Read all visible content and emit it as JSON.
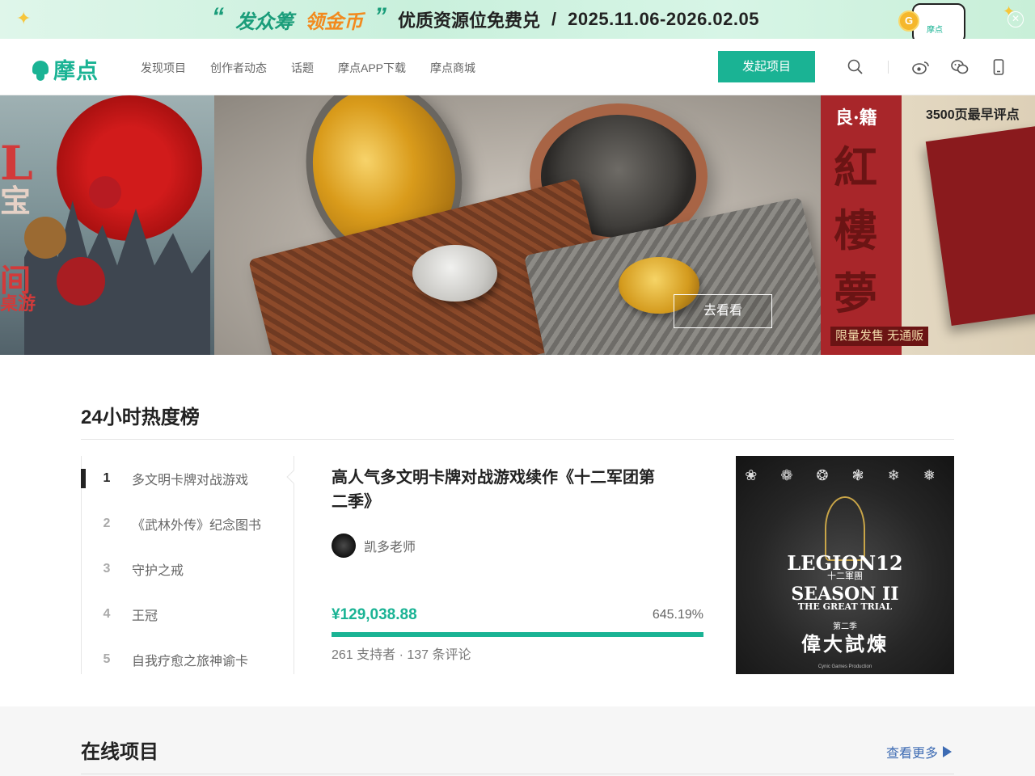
{
  "promo": {
    "quote_open": "“",
    "highlight_1": "发众筹",
    "highlight_2": "领金币",
    "quote_close": "”",
    "description": "优质资源位免费兑",
    "separator": "/",
    "date_range": "2025.11.06-2026.02.05",
    "coin_label": "G",
    "phone_label": "摩点",
    "close_icon": "close-icon",
    "colors": {
      "accent": "#1a9d7a",
      "orange": "#f28a1e"
    }
  },
  "nav": {
    "logo_text": "摩点",
    "menu": [
      {
        "label": "发现项目"
      },
      {
        "label": "创作者动态"
      },
      {
        "label": "话题"
      },
      {
        "label": "摩点APP下载"
      },
      {
        "label": "摩点商城"
      }
    ],
    "cta_label": "发起项目",
    "icons": [
      "search-icon",
      "weibo-icon",
      "wechat-icon",
      "mobile-icon"
    ],
    "brand_color": "#1ab394"
  },
  "hero": {
    "left_slide_chars": [
      "L",
      "宝",
      "间",
      "桌游"
    ],
    "center_button": "去看看",
    "right_slide": {
      "brand": "良·籍",
      "title": "紅樓夢",
      "top_text": "3500页最早评点",
      "bottom_text": "限量发售 无通贩"
    }
  },
  "hot": {
    "title": "24小时热度榜",
    "ranks": [
      {
        "num": "1",
        "name": "多文明卡牌对战游戏"
      },
      {
        "num": "2",
        "name": "《武林外传》纪念图书"
      },
      {
        "num": "3",
        "name": "守护之戒"
      },
      {
        "num": "4",
        "name": "王冠"
      },
      {
        "num": "5",
        "name": "自我疗愈之旅神谕卡"
      }
    ],
    "active_index": 0,
    "project": {
      "title": "高人气多文明卡牌对战游戏续作《十二军团第二季》",
      "creator": "凯多老师",
      "amount": "¥129,038.88",
      "percent": "645.19%",
      "progress_fraction": 1.0,
      "meta": "261 支持者 · 137 条评论"
    },
    "cover": {
      "emblems": "❀ ❁ ❂ ❃ ❄ ❅",
      "line1": "LEGION12",
      "line2": "十二軍團",
      "line3": "SEASON II",
      "line4": "THE GREAT TRIAL",
      "line5": "第二季",
      "line6": "偉大試煉",
      "line7": "Cynic Games Production"
    }
  },
  "online": {
    "title": "在线项目",
    "more_label": "查看更多"
  }
}
